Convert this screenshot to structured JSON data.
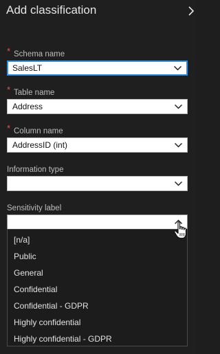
{
  "header": {
    "title": "Add classification"
  },
  "fields": {
    "schema": {
      "label": "Schema name",
      "required": "*",
      "value": "SalesLT"
    },
    "table": {
      "label": "Table name",
      "required": "*",
      "value": "Address"
    },
    "column": {
      "label": "Column name",
      "required": "*",
      "value": "AddressID (int)"
    },
    "info_type": {
      "label": "Information type",
      "value": ""
    },
    "sensitivity": {
      "label": "Sensitivity label",
      "value": ""
    }
  },
  "sensitivity_options": [
    "[n/a]",
    "Public",
    "General",
    "Confidential",
    "Confidential - GDPR",
    "Highly confidential",
    "Highly confidential - GDPR"
  ],
  "colors": {
    "background": "#1f1f1f",
    "focus": "#2f8ee6",
    "required": "#e05252"
  }
}
